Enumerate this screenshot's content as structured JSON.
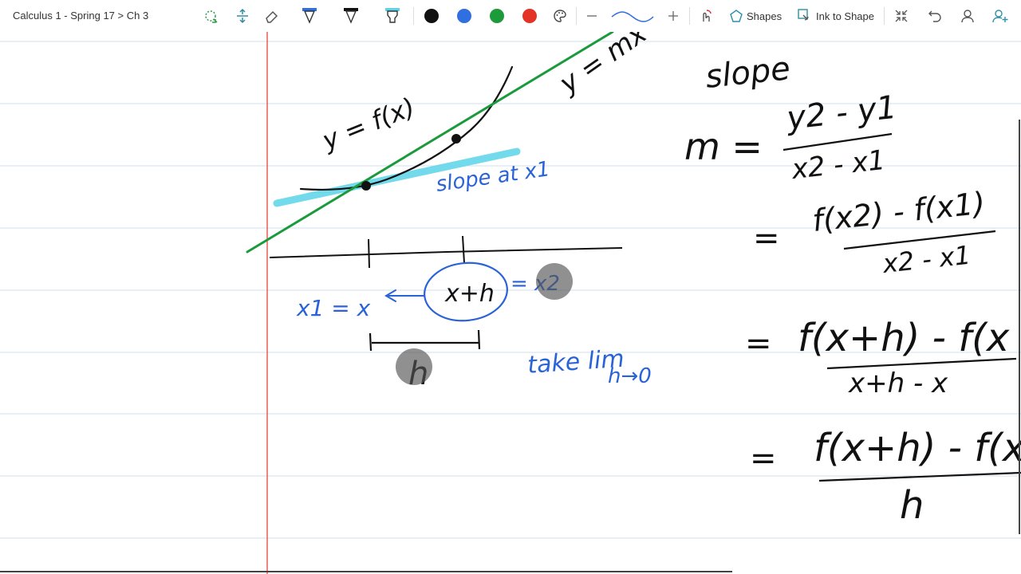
{
  "breadcrumb": "Calculus 1 - Spring 17 > Ch 3",
  "toolbar": {
    "shapes_label": "Shapes",
    "ink_to_shape_label": "Ink to Shape",
    "colors": {
      "black": "#111111",
      "blue": "#2f6fe0",
      "green": "#1d9a3a",
      "red": "#e53226"
    }
  },
  "notebook": {
    "line_color": "#dbe8f2",
    "margin_color": "#e8453c",
    "ink": {
      "black": "#111111",
      "blue": "#2a63d8",
      "green": "#1b9a3c",
      "highlight": "#64d6ea"
    }
  },
  "ink_text": {
    "y_equals_fx": "y = f(x)",
    "y_equals_mx": "y = mx",
    "slope_title": "slope",
    "slope_at_x1": "slope at x1",
    "x1_equals_x": "x1 = x",
    "x_plus_h": "x+h",
    "equals_x2": "= x2",
    "h_label": "h",
    "take_lim": "take lim",
    "h_to_0": "h→0",
    "m_equals": "m =",
    "frac1_num": "y2 - y1",
    "frac1_den": "x2 - x1",
    "eq": "=",
    "frac2_num": "f(x2) - f(x1)",
    "frac2_den": "x2 - x1",
    "frac3_num": "f(x+h) - f(x",
    "frac3_den": "x+h - x",
    "frac4_num": "f(x+h) - f(x",
    "frac4_den": "h"
  }
}
